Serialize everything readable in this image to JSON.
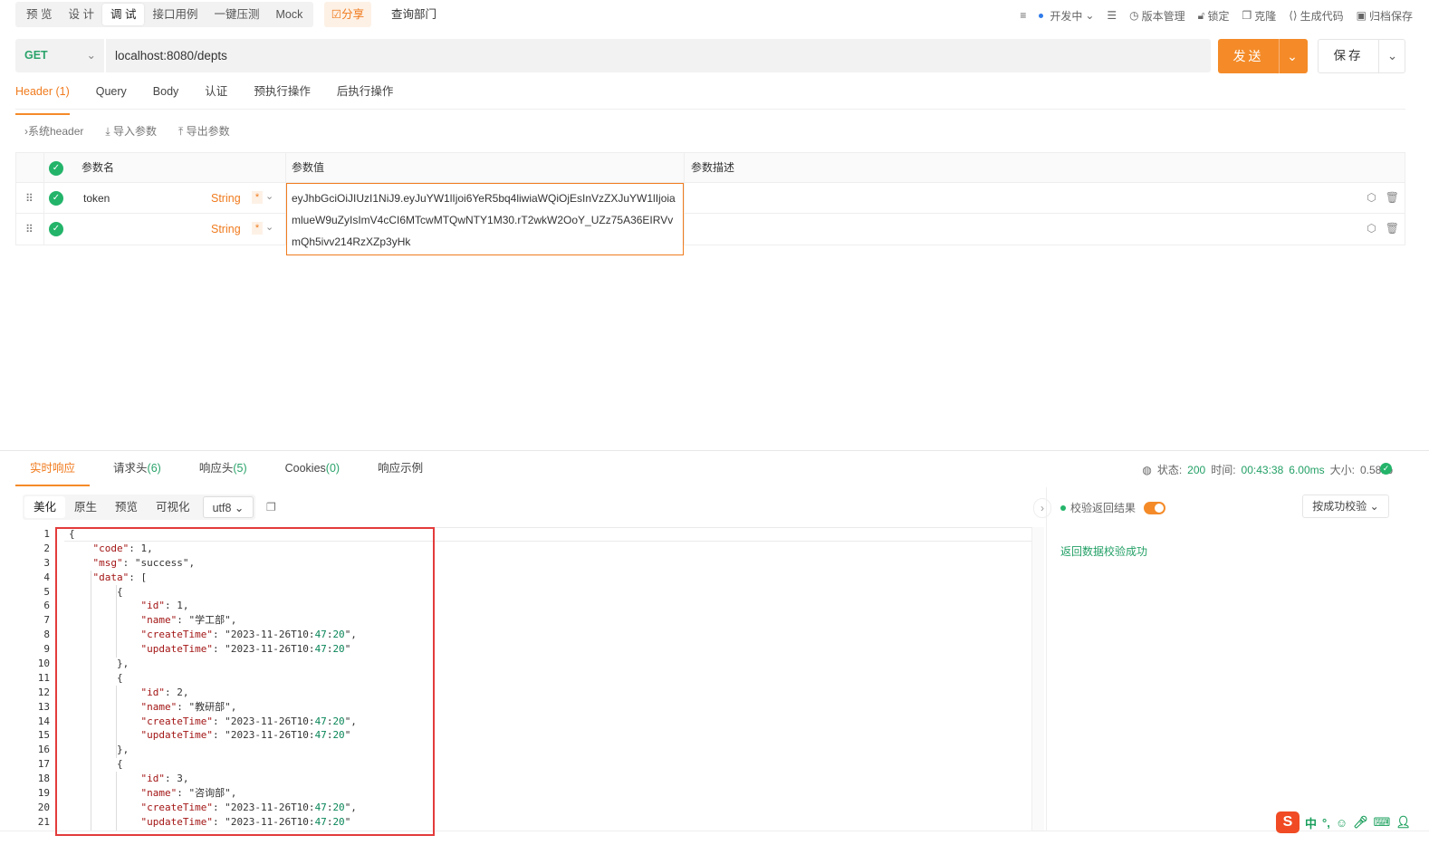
{
  "top": {
    "mode_tabs": [
      "预 览",
      "设 计",
      "调 试",
      "接口用例",
      "一键压测",
      "Mock"
    ],
    "share_label": "☑分享",
    "api_name": "查询部门",
    "status_text": "开发中",
    "tools": [
      "版本管理",
      "锁定",
      "克隆",
      "生成代码",
      "归档保存"
    ]
  },
  "request": {
    "method": "GET",
    "url": "localhost:8080/depts",
    "send_label": "发送",
    "save_label": "保存"
  },
  "req_tabs": [
    "Header (1)",
    "Query",
    "Body",
    "认证",
    "预执行操作",
    "后执行操作"
  ],
  "sub_tools": [
    "系统header",
    "导入参数",
    "导出参数"
  ],
  "header_table": {
    "columns": [
      "参数名",
      "参数值",
      "参数描述"
    ],
    "rows": [
      {
        "name": "token",
        "type": "String",
        "required": "*"
      },
      {
        "name": "",
        "type": "String",
        "required": "*"
      }
    ],
    "token_value": "eyJhbGciOiJIUzI1NiJ9.eyJuYW1lIjoi6YeR5bq4liwiaWQiOjEsInVzZXJuYW1lIjoiamlueW9uZyIsImV4cCI6MTcwMTQwNTY1M30.rT2wkW2OoY_UZz75A36EIRVvmQh5ivv214RzXZp3yHk"
  },
  "resp_tabs": [
    {
      "label": "实时响应",
      "count": ""
    },
    {
      "label": "请求头",
      "count": "(6)"
    },
    {
      "label": "响应头",
      "count": "(5)"
    },
    {
      "label": "Cookies",
      "count": "(0)"
    },
    {
      "label": "响应示例",
      "count": ""
    }
  ],
  "status": {
    "state_label": "状态:",
    "state_value": "200",
    "time_label": "时间:",
    "time_value": "00:43:38",
    "duration": "6.00ms",
    "size_label": "大小:",
    "size_value": "0.58kb"
  },
  "view_modes": [
    "美化",
    "原生",
    "预览",
    "可视化"
  ],
  "encoding": "utf8",
  "validation": {
    "label": "校验返回结果",
    "mode": "按成功校验",
    "result": "返回数据校验成功"
  },
  "response_lines": [
    "{",
    "    \"code\": 1,",
    "    \"msg\": \"success\",",
    "    \"data\": [",
    "        {",
    "            \"id\": 1,",
    "            \"name\": \"学工部\",",
    "            \"createTime\": \"2023-11-26T10:47:20\",",
    "            \"updateTime\": \"2023-11-26T10:47:20\"",
    "        },",
    "        {",
    "            \"id\": 2,",
    "            \"name\": \"教研部\",",
    "            \"createTime\": \"2023-11-26T10:47:20\",",
    "            \"updateTime\": \"2023-11-26T10:47:20\"",
    "        },",
    "        {",
    "            \"id\": 3,",
    "            \"name\": \"咨询部\",",
    "            \"createTime\": \"2023-11-26T10:47:20\",",
    "            \"updateTime\": \"2023-11-26T10:47:20\""
  ],
  "ime": {
    "lang": "中",
    "punct": "°,"
  }
}
